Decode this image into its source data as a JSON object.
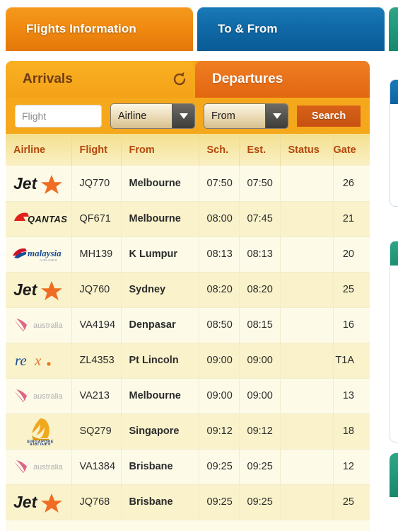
{
  "topnav": {
    "tabs": [
      {
        "label": "Flights Information",
        "color": "#ef8a10",
        "active": true
      },
      {
        "label": "To & From",
        "color": "#0f6aa6",
        "active": false
      },
      {
        "label": "",
        "color": "#229a7c",
        "active": false
      }
    ]
  },
  "panel": {
    "subtabs": [
      {
        "label": "Arrivals",
        "active": true
      },
      {
        "label": "Departures",
        "active": false
      }
    ],
    "refresh_icon": "refresh-icon"
  },
  "search": {
    "flight_placeholder": "Flight",
    "flight_value": "",
    "airline_label": "Airline",
    "from_label": "From",
    "search_label": "Search"
  },
  "table": {
    "headers": [
      "Airline",
      "Flight",
      "From",
      "Sch.",
      "Est.",
      "Status",
      "Gate"
    ],
    "rows": [
      {
        "airline": "Jetstar",
        "logo": "jetstar",
        "flight": "JQ770",
        "from": "Melbourne",
        "sch": "07:50",
        "est": "07:50",
        "status": "",
        "gate": "26"
      },
      {
        "airline": "Qantas",
        "logo": "qantas",
        "flight": "QF671",
        "from": "Melbourne",
        "sch": "08:00",
        "est": "07:45",
        "status": "",
        "gate": "21"
      },
      {
        "airline": "Malaysia Airlines",
        "logo": "malaysia",
        "flight": "MH139",
        "from": "K Lumpur",
        "sch": "08:13",
        "est": "08:13",
        "status": "",
        "gate": "20"
      },
      {
        "airline": "Jetstar",
        "logo": "jetstar",
        "flight": "JQ760",
        "from": "Sydney",
        "sch": "08:20",
        "est": "08:20",
        "status": "",
        "gate": "25"
      },
      {
        "airline": "Virgin Australia",
        "logo": "virgin",
        "flight": "VA4194",
        "from": "Denpasar",
        "sch": "08:50",
        "est": "08:15",
        "status": "",
        "gate": "16"
      },
      {
        "airline": "Rex",
        "logo": "rex",
        "flight": "ZL4353",
        "from": "Pt Lincoln",
        "sch": "09:00",
        "est": "09:00",
        "status": "",
        "gate": "T1A"
      },
      {
        "airline": "Virgin Australia",
        "logo": "virgin",
        "flight": "VA213",
        "from": "Melbourne",
        "sch": "09:00",
        "est": "09:00",
        "status": "",
        "gate": "13"
      },
      {
        "airline": "Singapore Airlines",
        "logo": "singapore",
        "flight": "SQ279",
        "from": "Singapore",
        "sch": "09:12",
        "est": "09:12",
        "status": "",
        "gate": "18"
      },
      {
        "airline": "Virgin Australia",
        "logo": "virgin",
        "flight": "VA1384",
        "from": "Brisbane",
        "sch": "09:25",
        "est": "09:25",
        "status": "",
        "gate": "12"
      },
      {
        "airline": "Jetstar",
        "logo": "jetstar",
        "flight": "JQ768",
        "from": "Brisbane",
        "sch": "09:25",
        "est": "09:25",
        "status": "",
        "gate": "25"
      }
    ]
  },
  "colors": {
    "tab_orange": "#ef8a10",
    "tab_blue": "#0f6aa6",
    "tab_green": "#229a7c",
    "panel_amber": "#f6a81c",
    "departures_orange": "#e8701a",
    "header_text": "#b5470d",
    "row_odd": "#fdfbe8",
    "row_even": "#f9f2cb",
    "search_button": "#cf5a15"
  }
}
